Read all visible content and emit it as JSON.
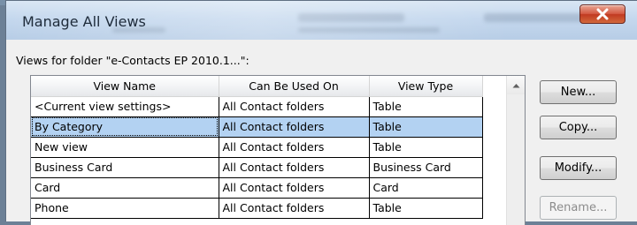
{
  "window": {
    "title": "Manage All Views",
    "close_icon": "close-x-icon",
    "close_color": "#c7452b"
  },
  "views_label": "Views for folder \"e-Contacts EP 2010.1...\":",
  "table": {
    "columns": [
      "View Name",
      "Can Be Used On",
      "View Type"
    ],
    "rows": [
      {
        "name": "<Current view settings>",
        "used_on": "All Contact folders",
        "type": "Table",
        "selected": false
      },
      {
        "name": "By Category",
        "used_on": "All Contact folders",
        "type": "Table",
        "selected": true
      },
      {
        "name": "New view",
        "used_on": "All Contact folders",
        "type": "Table",
        "selected": false
      },
      {
        "name": "Business Card",
        "used_on": "All Contact folders",
        "type": "Business Card",
        "selected": false
      },
      {
        "name": "Card",
        "used_on": "All Contact folders",
        "type": "Card",
        "selected": false
      },
      {
        "name": "Phone",
        "used_on": "All Contact folders",
        "type": "Table",
        "selected": false
      }
    ],
    "selection_color": "#b3d2f2"
  },
  "buttons": {
    "new": "New...",
    "copy": "Copy...",
    "modify": "Modify...",
    "rename": "Rename..."
  }
}
